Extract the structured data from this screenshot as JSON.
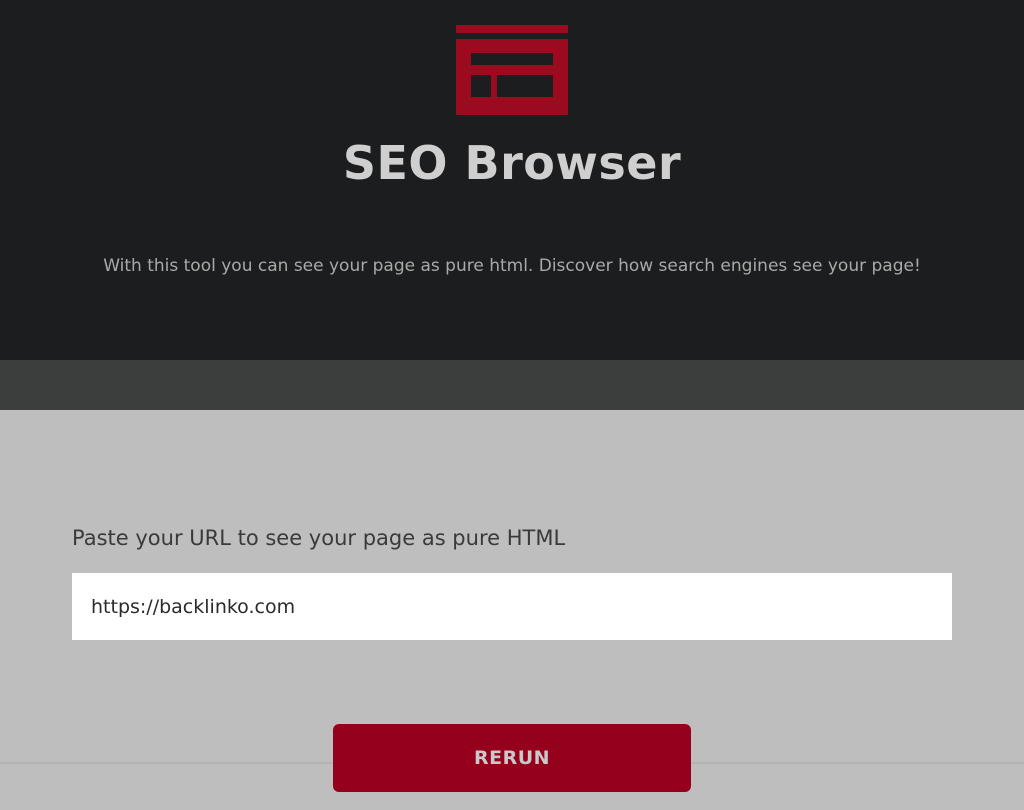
{
  "header": {
    "title": "SEO Browser",
    "subtitle": "With this tool you can see your page as pure html. Discover how search engines see your page!",
    "logo_icon": "browser-window-icon",
    "logo_color": "#9a0b1f"
  },
  "form": {
    "label": "Paste your URL to see your page as pure HTML",
    "url_value": "https://backlinko.com",
    "button_label": "RERUN",
    "button_color": "#95001c"
  }
}
